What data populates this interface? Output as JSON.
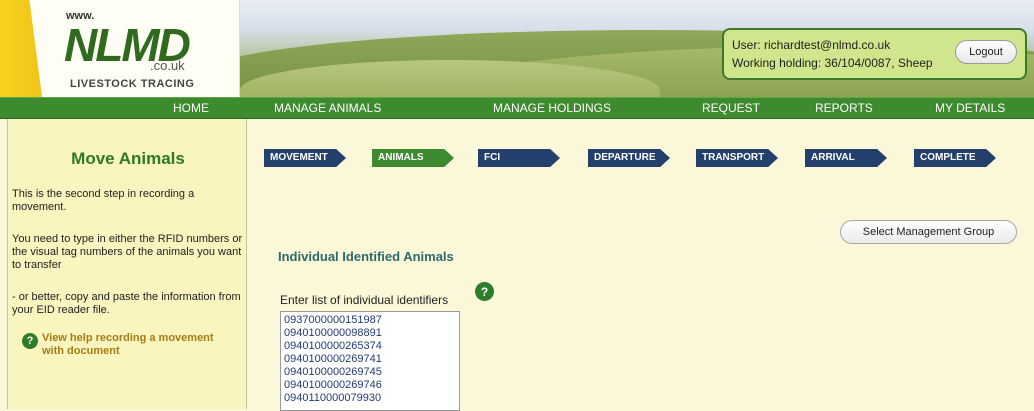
{
  "logo": {
    "www": "www.",
    "name": "NLMD",
    "suffix": ".co.uk",
    "tagline": "LIVESTOCK TRACING"
  },
  "user_box": {
    "user_line": "User: richardtest@nlmd.co.uk",
    "holding_line": "Working holding: 36/104/0087, Sheep",
    "logout_label": "Logout"
  },
  "nav": [
    {
      "label": "HOME"
    },
    {
      "label": "MANAGE ANIMALS"
    },
    {
      "label": "MANAGE HOLDINGS"
    },
    {
      "label": "REQUEST"
    },
    {
      "label": "REPORTS"
    },
    {
      "label": "MY DETAILS"
    }
  ],
  "sidebar": {
    "title": "Move Animals",
    "p1": "This is the second step in recording a movement.",
    "p2": "You need to type in either the RFID numbers or the visual tag numbers of the animals you want to transfer",
    "p3": "- or better, copy and paste the information from your EID reader file.",
    "help_icon": "?",
    "help_link": "View help recording a movement with document"
  },
  "steps": [
    {
      "label": "MOVEMENT",
      "active": false
    },
    {
      "label": "ANIMALS",
      "active": true
    },
    {
      "label": "FCI",
      "active": false
    },
    {
      "label": "DEPARTURE",
      "active": false
    },
    {
      "label": "TRANSPORT",
      "active": false
    },
    {
      "label": "ARRIVAL",
      "active": false
    },
    {
      "label": "COMPLETE",
      "active": false
    }
  ],
  "main": {
    "management_group_button": "Select Management Group",
    "section_title": "Individual Identified Animals",
    "enter_label": "Enter list of individual identifiers",
    "help_icon": "?",
    "identifiers": [
      "0937000000151987",
      "0940100000098891",
      "0940100000265374",
      "0940100000269741",
      "0940100000269745",
      "0940100000269746",
      "0940110000079930"
    ]
  },
  "colors": {
    "brand_green": "#3e8a2f",
    "step_blue": "#233f6b",
    "sidebar_bg": "#faf4bf",
    "page_bg": "#fbf7d9",
    "help_link_gold": "#a67d14"
  }
}
